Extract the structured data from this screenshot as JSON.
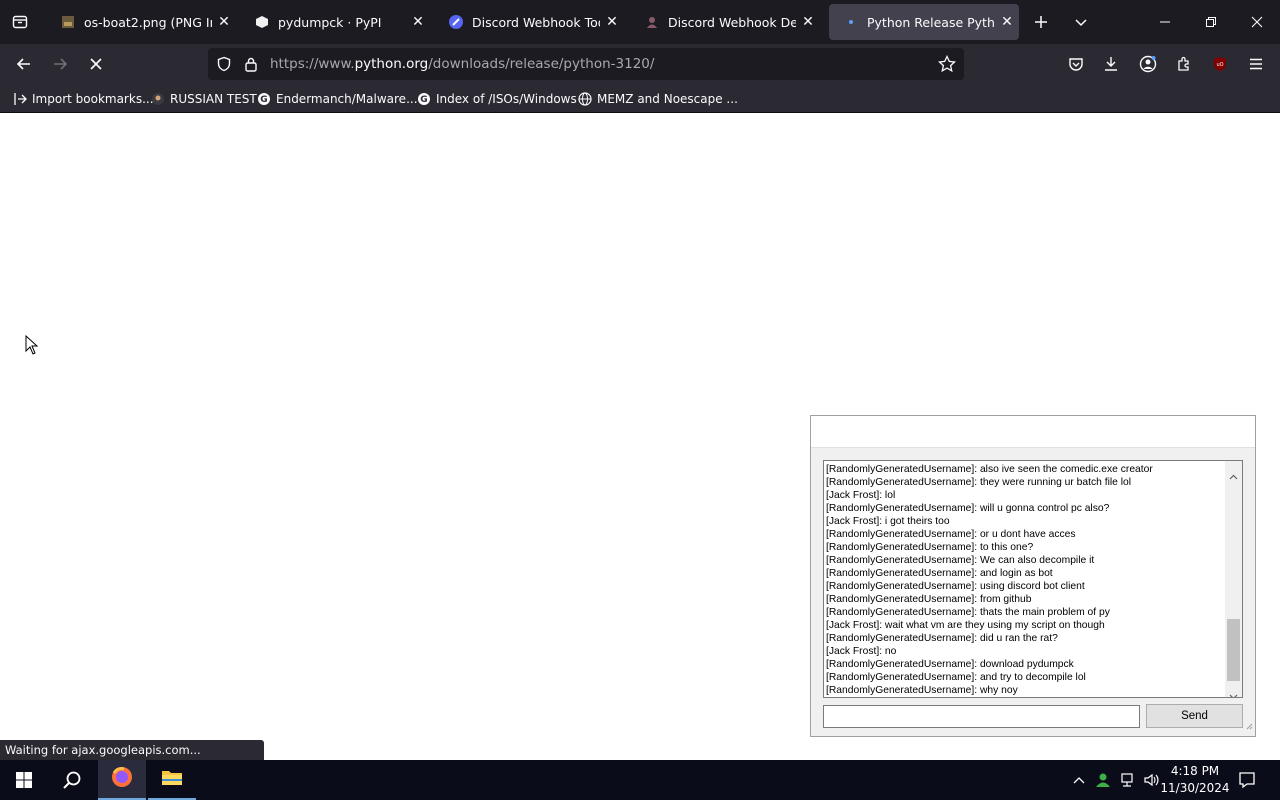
{
  "tabs": [
    {
      "title": "os-boat2.png (PNG Image",
      "icon": "image-icon"
    },
    {
      "title": "pydumpck · PyPI",
      "icon": "pypi-icon"
    },
    {
      "title": "Discord Webhook Tool | C",
      "icon": "discord-tool-icon"
    },
    {
      "title": "Discord Webhook Deleter",
      "icon": "discord-deleter-icon"
    },
    {
      "title": "Python Release Python 3.",
      "icon": "loading-icon",
      "active": true
    }
  ],
  "url": {
    "prefix": "https://www.",
    "host": "python.org",
    "path": "/downloads/release/python-3120/"
  },
  "bookmarks": [
    {
      "label": "Import bookmarks...",
      "icon": "import-icon"
    },
    {
      "label": "RUSSIAN TEST",
      "icon": "bookmark-site-icon"
    },
    {
      "label": "Endermanch/Malware...",
      "icon": "google-icon"
    },
    {
      "label": "Index of /ISOs/Windows",
      "icon": "google-icon"
    },
    {
      "label": "MEMZ and Noescape ...",
      "icon": "globe-icon"
    }
  ],
  "chat": {
    "messages": [
      "[RandomlyGeneratedUsername]: also ive seen the comedic.exe creator",
      "[RandomlyGeneratedUsername]: they were running ur batch file lol",
      "[Jack Frost]: lol",
      "[RandomlyGeneratedUsername]: will u gonna control pc also?",
      "[Jack Frost]: i got theirs too",
      "[RandomlyGeneratedUsername]: or u dont have acces",
      "[RandomlyGeneratedUsername]: to this one?",
      "[RandomlyGeneratedUsername]: We can also decompile it",
      "[RandomlyGeneratedUsername]: and login as bot",
      "[RandomlyGeneratedUsername]: using discord bot client",
      "[RandomlyGeneratedUsername]: from github",
      "[RandomlyGeneratedUsername]: thats the main problem of py",
      "[Jack Frost]: wait what vm are they using my script on though",
      "[RandomlyGeneratedUsername]: did u ran the rat?",
      "[Jack Frost]: no",
      "[RandomlyGeneratedUsername]: download pydumpck",
      "[RandomlyGeneratedUsername]: and try to decompile lol",
      "[RandomlyGeneratedUsername]: why noy"
    ],
    "input_value": "",
    "send_label": "Send"
  },
  "status_text": "Waiting for ajax.googleapis.com...",
  "clock": {
    "time": "4:18 PM",
    "date": "11/30/2024"
  },
  "colors": {
    "chrome_dark": "#1c1b22",
    "toolbar": "#2b2a33",
    "active_tab": "#42414d",
    "taskbar": "#0b0c1a"
  }
}
